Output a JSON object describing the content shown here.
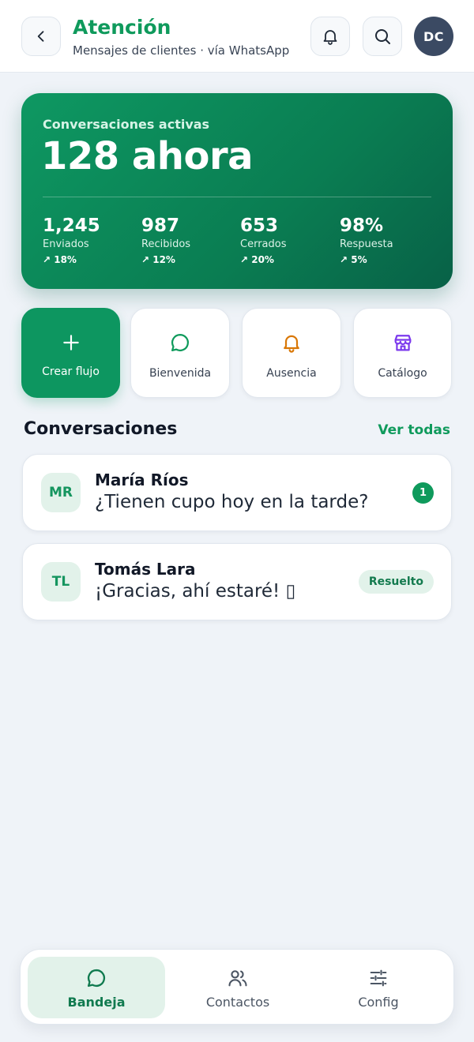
{
  "header": {
    "title": "Atención",
    "subtitle": "Mensajes de clientes · vía WhatsApp",
    "avatar_initials": "DC",
    "icons": [
      "chevron-left-icon",
      "bell-icon",
      "search-icon"
    ]
  },
  "hero": {
    "label": "Conversaciones activas",
    "value": "128 ahora",
    "stats": [
      {
        "value": "1,245",
        "label": "Enviados",
        "change": "↗ 18%"
      },
      {
        "value": "987",
        "label": "Recibidos",
        "change": "↗ 12%"
      },
      {
        "value": "653",
        "label": "Cerrados",
        "change": "↗ 20%"
      },
      {
        "value": "98%",
        "label": "Respuesta",
        "change": "↗ 5%"
      }
    ]
  },
  "quick_actions": [
    {
      "label": "Crear flujo",
      "icon": "plus-icon"
    },
    {
      "label": "Bienvenida",
      "icon": "chat-bubble-icon"
    },
    {
      "label": "Ausencia",
      "icon": "bell-icon"
    },
    {
      "label": "Catálogo",
      "icon": "store-icon"
    }
  ],
  "conversations_section": {
    "title": "Conversaciones",
    "view_all": "Ver todas",
    "items": [
      {
        "initials": "MR",
        "name": "María Ríos",
        "message": "¿Tienen cupo hoy en la tarde?",
        "unread": "1"
      },
      {
        "initials": "TL",
        "name": "Tomás Lara",
        "message": "¡Gracias, ahí estaré! ▯",
        "status": "Resuelto"
      }
    ]
  },
  "bottom_nav": [
    {
      "label": "Bandeja",
      "icon": "chat-bubble-icon",
      "active": true
    },
    {
      "label": "Contactos",
      "icon": "users-icon"
    },
    {
      "label": "Config",
      "icon": "sliders-icon"
    }
  ],
  "colors": {
    "accent": "#0f9a5c",
    "hero_start": "#0e9862",
    "hero_end": "#086147",
    "avatar_bg": "#3b4a63",
    "page_bg": "#eff3f8",
    "away_icon": "#d97706",
    "catalog_icon": "#7c3aed"
  }
}
